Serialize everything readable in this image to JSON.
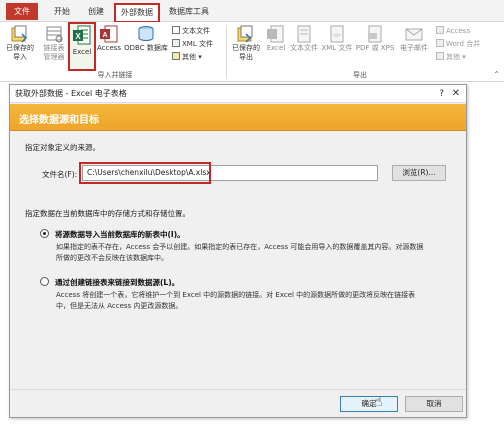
{
  "tabs": [
    {
      "label": "文件",
      "state": "file"
    },
    {
      "label": "开始",
      "state": ""
    },
    {
      "label": "创建",
      "state": ""
    },
    {
      "label": "外部数据",
      "state": "active"
    },
    {
      "label": "数据库工具",
      "state": ""
    }
  ],
  "ribbon": {
    "import_group": {
      "label": "导入并链接",
      "saved_imports": "已保存的\n导入",
      "linked_table_manager": "链接表\n管理器",
      "excel": "Excel",
      "access": "Access",
      "odbc": "ODBC 数据库",
      "text_file": "文本文件",
      "xml_file": "XML 文件",
      "more": "其他"
    },
    "export_group": {
      "label": "导出",
      "saved_exports": "已保存的\n导出",
      "excel": "Excel",
      "text_file": "文本文件",
      "xml_file": "XML 文件",
      "pdf_xps": "PDF 或 XPS",
      "email": "电子邮件",
      "access": "Access",
      "word_merge": "Word 合并",
      "more": "其他"
    }
  },
  "dialog": {
    "title": "获取外部数据 - Excel 电子表格",
    "help": "?",
    "close": "✕",
    "banner": "选择数据源和目标",
    "source_prompt": "指定对象定义的来源。",
    "file_label": "文件名(F):",
    "file_value": "C:\\Users\\chenxilu\\Desktop\\A.xlsx",
    "browse": "浏览(R)...",
    "storage_prompt": "指定数据在当前数据库中的存储方式和存储位置。",
    "options": [
      {
        "label": "将源数据导入当前数据库的新表中(I)。",
        "selected": true,
        "desc": [
          "如果指定的表不存在，Access 会予以创建。如果指定的表已存在，Access 可能会用导入的数据覆盖其内容。对源数据",
          "所做的更改不会反映在该数据库中。"
        ]
      },
      {
        "label": "通过创建链接表来链接到数据源(L)。",
        "selected": false,
        "desc": [
          "Access 将创建一个表，它将维护一个到 Excel 中的源数据的链接。对 Excel 中的源数据所做的更改将反映在链接表",
          "中，但是无法从 Access 内更改源数据。"
        ]
      }
    ],
    "ok": "确定",
    "cancel": "取消"
  },
  "colors": {
    "file_tab": "#c0392b",
    "banner": "#f0ac30",
    "highlight": "#c62828",
    "excel_green": "#1d7044"
  }
}
